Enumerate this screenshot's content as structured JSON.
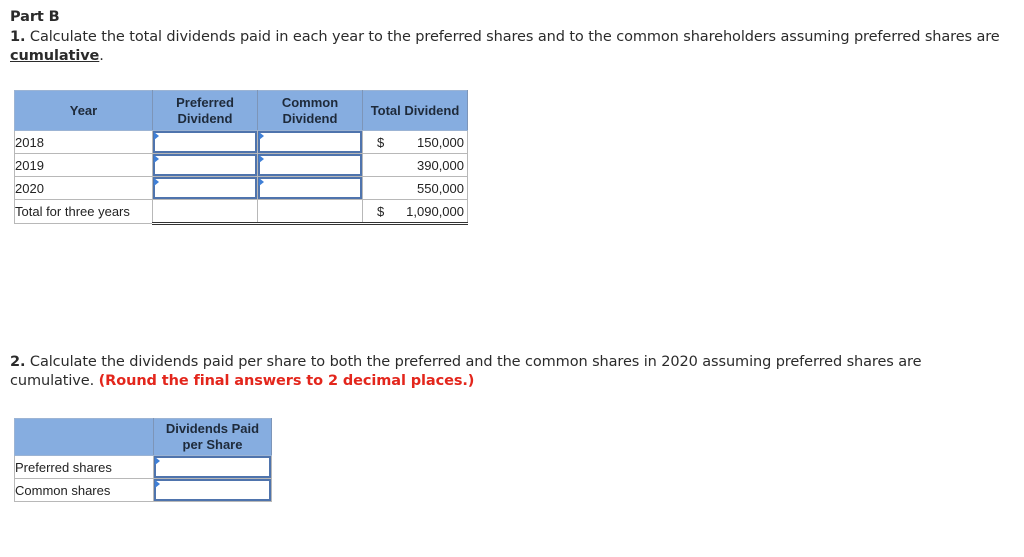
{
  "part_title": "Part B",
  "question1": {
    "number": "1.",
    "text_before": " Calculate the total dividends paid in each year to the preferred shares and to the common shareholders assuming preferred shares are ",
    "emphasis": "cumulative",
    "text_after": "."
  },
  "table1": {
    "headers": {
      "year": "Year",
      "preferred": "Preferred Dividend",
      "common": "Common Dividend",
      "total": "Total Dividend"
    },
    "rows": [
      {
        "label": "2018",
        "preferred_value": "",
        "common_value": "",
        "currency": "$",
        "total": "150,000"
      },
      {
        "label": "2019",
        "preferred_value": "",
        "common_value": "",
        "currency": "",
        "total": "390,000"
      },
      {
        "label": "2020",
        "preferred_value": "",
        "common_value": "",
        "currency": "",
        "total": "550,000"
      }
    ],
    "total_row": {
      "label": "Total for three years",
      "currency": "$",
      "total": "1,090,000"
    }
  },
  "question2": {
    "number": "2.",
    "text": " Calculate the dividends paid per share to both the preferred and the common shares in 2020 assuming preferred shares are cumulative. ",
    "instruction": "(Round the final answers to 2 decimal places.)"
  },
  "table2": {
    "headers": {
      "label": "",
      "value": "Dividends Paid per Share"
    },
    "rows": [
      {
        "label": "Preferred shares",
        "value": ""
      },
      {
        "label": "Common shares",
        "value": ""
      }
    ]
  },
  "colors": {
    "header_bg": "#86ade0",
    "input_border": "#4f74ad",
    "instruction_red": "#e3261c"
  }
}
